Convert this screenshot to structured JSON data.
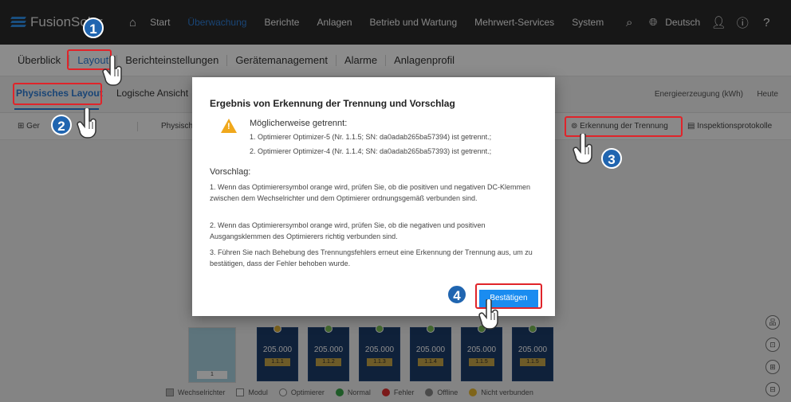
{
  "app": {
    "title": "FusionSolar"
  },
  "topnav": {
    "items": [
      "Start",
      "Überwachung",
      "Berichte",
      "Anlagen",
      "Betrieb und Wartung",
      "Mehrwert-Services",
      "System"
    ],
    "language": "Deutsch"
  },
  "subnav": {
    "items": [
      "Überblick",
      "Layout",
      "Berichteinstellungen",
      "Gerätemanagement",
      "Alarme",
      "Anlagenprofil"
    ]
  },
  "view_tabs": {
    "items": [
      "Physisches Layout",
      "Logische Ansicht"
    ]
  },
  "energy": {
    "label": "Energieerzeugung (kWh)",
    "period": "Heute"
  },
  "toolbar": {
    "left_label": "Ger",
    "physical_label": "Physische",
    "detect": "Erkennung der Trennung",
    "inspection": "Inspektionsprotokolle"
  },
  "modal": {
    "title": "Ergebnis von Erkennung der Trennung und Vorschlag",
    "heading": "Möglicherweise getrennt:",
    "lines": [
      "1. Optimierer Optimizer-5 (Nr. 1.1.5; SN: da0adab265ba57394) ist getrennt.;",
      "2. Optimierer Optimizer-4 (Nr. 1.1.4; SN: da0adab265ba57393) ist getrennt.;"
    ],
    "suggestion_title": "Vorschlag:",
    "suggestions": [
      "1. Wenn das Optimierersymbol orange wird, prüfen Sie, ob die positiven und negativen DC-Klemmen zwischen dem Wechselrichter und dem Optimierer ordnungsgemäß verbunden sind.",
      "2. Wenn das Optimierersymbol orange wird, prüfen Sie, ob die negativen und positiven Ausgangsklemmen des Optimierers richtig verbunden sind.",
      "3. Führen Sie nach Behebung des Trennungsfehlers erneut eine Erkennung der Trennung aus, um zu bestätigen, dass der Fehler behoben wurde."
    ],
    "confirm": "Bestätigen"
  },
  "layout_area": {
    "inverter_number": "1",
    "panels": [
      {
        "value": "205.000",
        "id": "1.1.1"
      },
      {
        "value": "205.000",
        "id": "1.1.2"
      },
      {
        "value": "205.000",
        "id": "1.1.3"
      },
      {
        "value": "205.000",
        "id": "1.1.4"
      },
      {
        "value": "205.000",
        "id": "1.1.5"
      },
      {
        "value": "205.000",
        "id": "1.1.5"
      }
    ]
  },
  "legend": [
    "Wechselrichter",
    "Modul",
    "Optimierer",
    "Normal",
    "Fehler",
    "Offline",
    "Nicht verbunden"
  ],
  "steps": [
    "1",
    "2",
    "3",
    "4"
  ]
}
